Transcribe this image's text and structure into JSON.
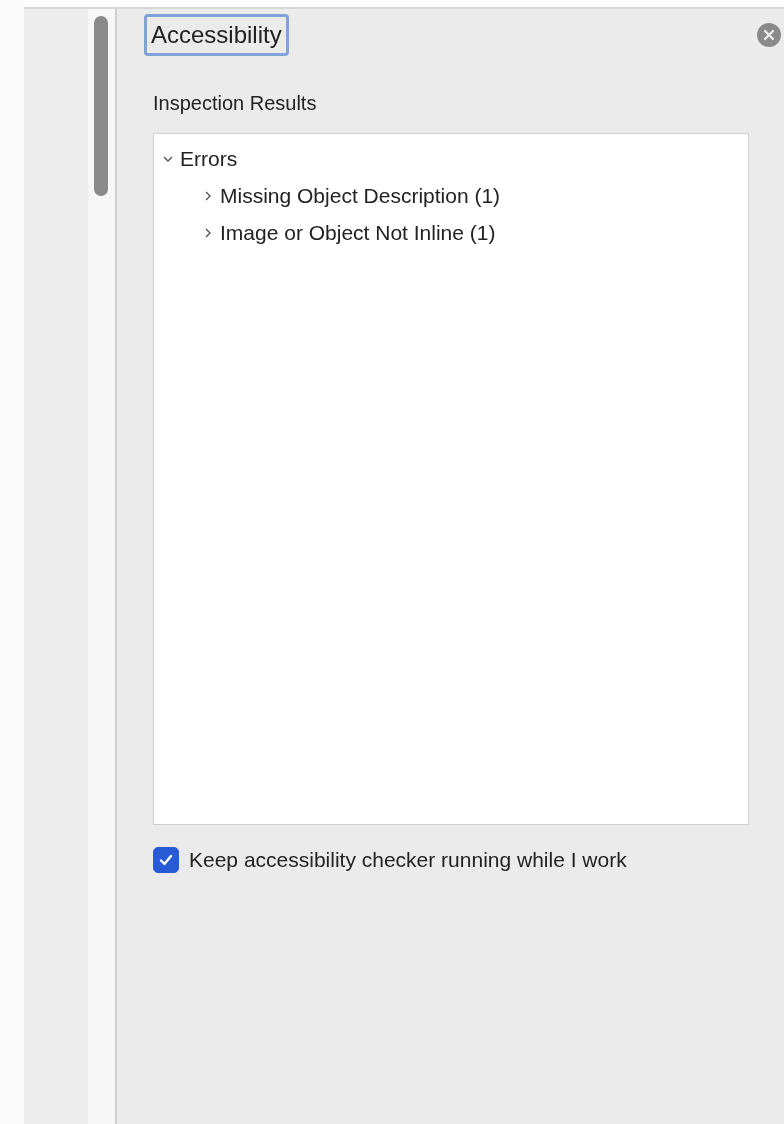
{
  "panel": {
    "title": "Accessibility",
    "section_label": "Inspection Results"
  },
  "tree": [
    {
      "label": "Errors",
      "expanded": true,
      "children": [
        {
          "label": "Missing Object Description (1)",
          "expanded": false
        },
        {
          "label": "Image or Object Not Inline (1)",
          "expanded": false
        }
      ]
    }
  ],
  "option": {
    "label": "Keep accessibility checker running while I work",
    "checked": true
  }
}
